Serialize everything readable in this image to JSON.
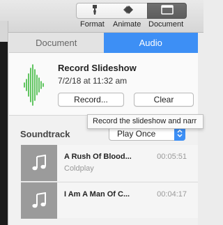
{
  "toolbar": {
    "format": {
      "label": "Format",
      "icon": "paintbrush-icon"
    },
    "animate": {
      "label": "Animate",
      "icon": "diamond-icon"
    },
    "document": {
      "label": "Document",
      "icon": "document-window-icon"
    }
  },
  "inspector": {
    "tabs": [
      {
        "label": "Document",
        "active": false
      },
      {
        "label": "Audio",
        "active": true
      }
    ],
    "record": {
      "title": "Record Slideshow",
      "date": "7/2/18 at 11:32 am",
      "record_button": "Record...",
      "clear_button": "Clear"
    },
    "soundtrack": {
      "label": "Soundtrack",
      "mode": "Play Once"
    },
    "tracks": [
      {
        "title": "A Rush Of Blood...",
        "artist": "Coldplay",
        "duration": "00:05:51"
      },
      {
        "title": "I Am A Man Of C...",
        "artist": "",
        "duration": "00:04:17"
      }
    ]
  },
  "tooltip": "Record the slideshow and narr",
  "colors": {
    "accent": "#3d8ff5",
    "waveform": "#3cb83c",
    "artwork": "#9b9b9b"
  }
}
